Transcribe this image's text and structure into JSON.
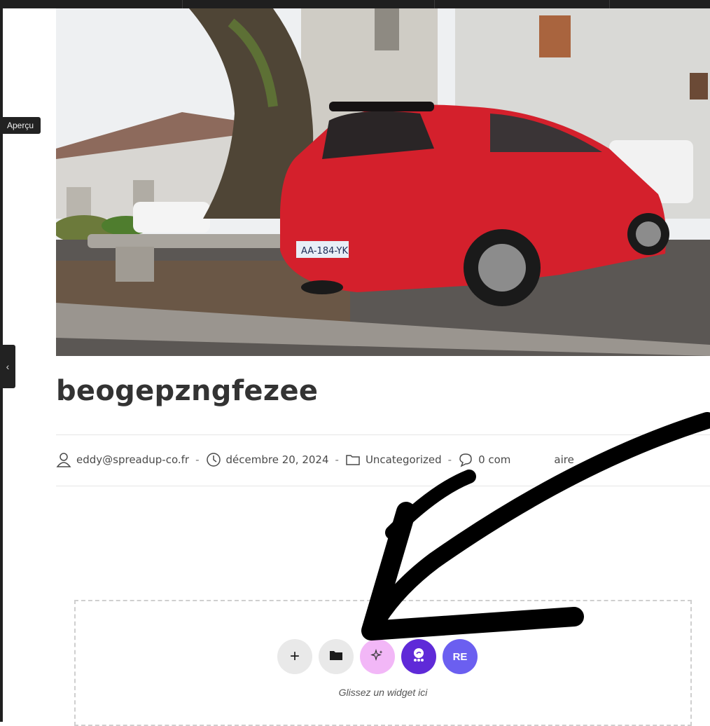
{
  "preview": {
    "label": "Aperçu"
  },
  "collapse": {
    "label": "‹"
  },
  "post": {
    "title": "beogepzngfezee",
    "author": "eddy@spreadup-co.fr",
    "date": "décembre 20, 2024",
    "category": "Uncategorized",
    "comments_visible": "0 com",
    "comments_visible_tail": "aire",
    "separator": "-"
  },
  "photo": {
    "plate": "AA-184-YK",
    "colors": {
      "car": "#d4202c",
      "sky": "#eef0f2",
      "ground": "#5b5754"
    }
  },
  "dropzone": {
    "buttons": [
      {
        "name": "add-element",
        "glyph": "+"
      },
      {
        "name": "templates",
        "icon": "folder-icon"
      },
      {
        "name": "ai-assistant",
        "icon": "sparkle-icon"
      },
      {
        "name": "extension",
        "icon": "cloud-icon"
      },
      {
        "name": "re-widget",
        "glyph": "RE"
      }
    ],
    "hint": "Glissez un widget ici"
  },
  "colors": {
    "ai": "#f2b7f7",
    "ext": "#5f2ad8",
    "re": "#6b5ff0",
    "text": "#333333"
  }
}
